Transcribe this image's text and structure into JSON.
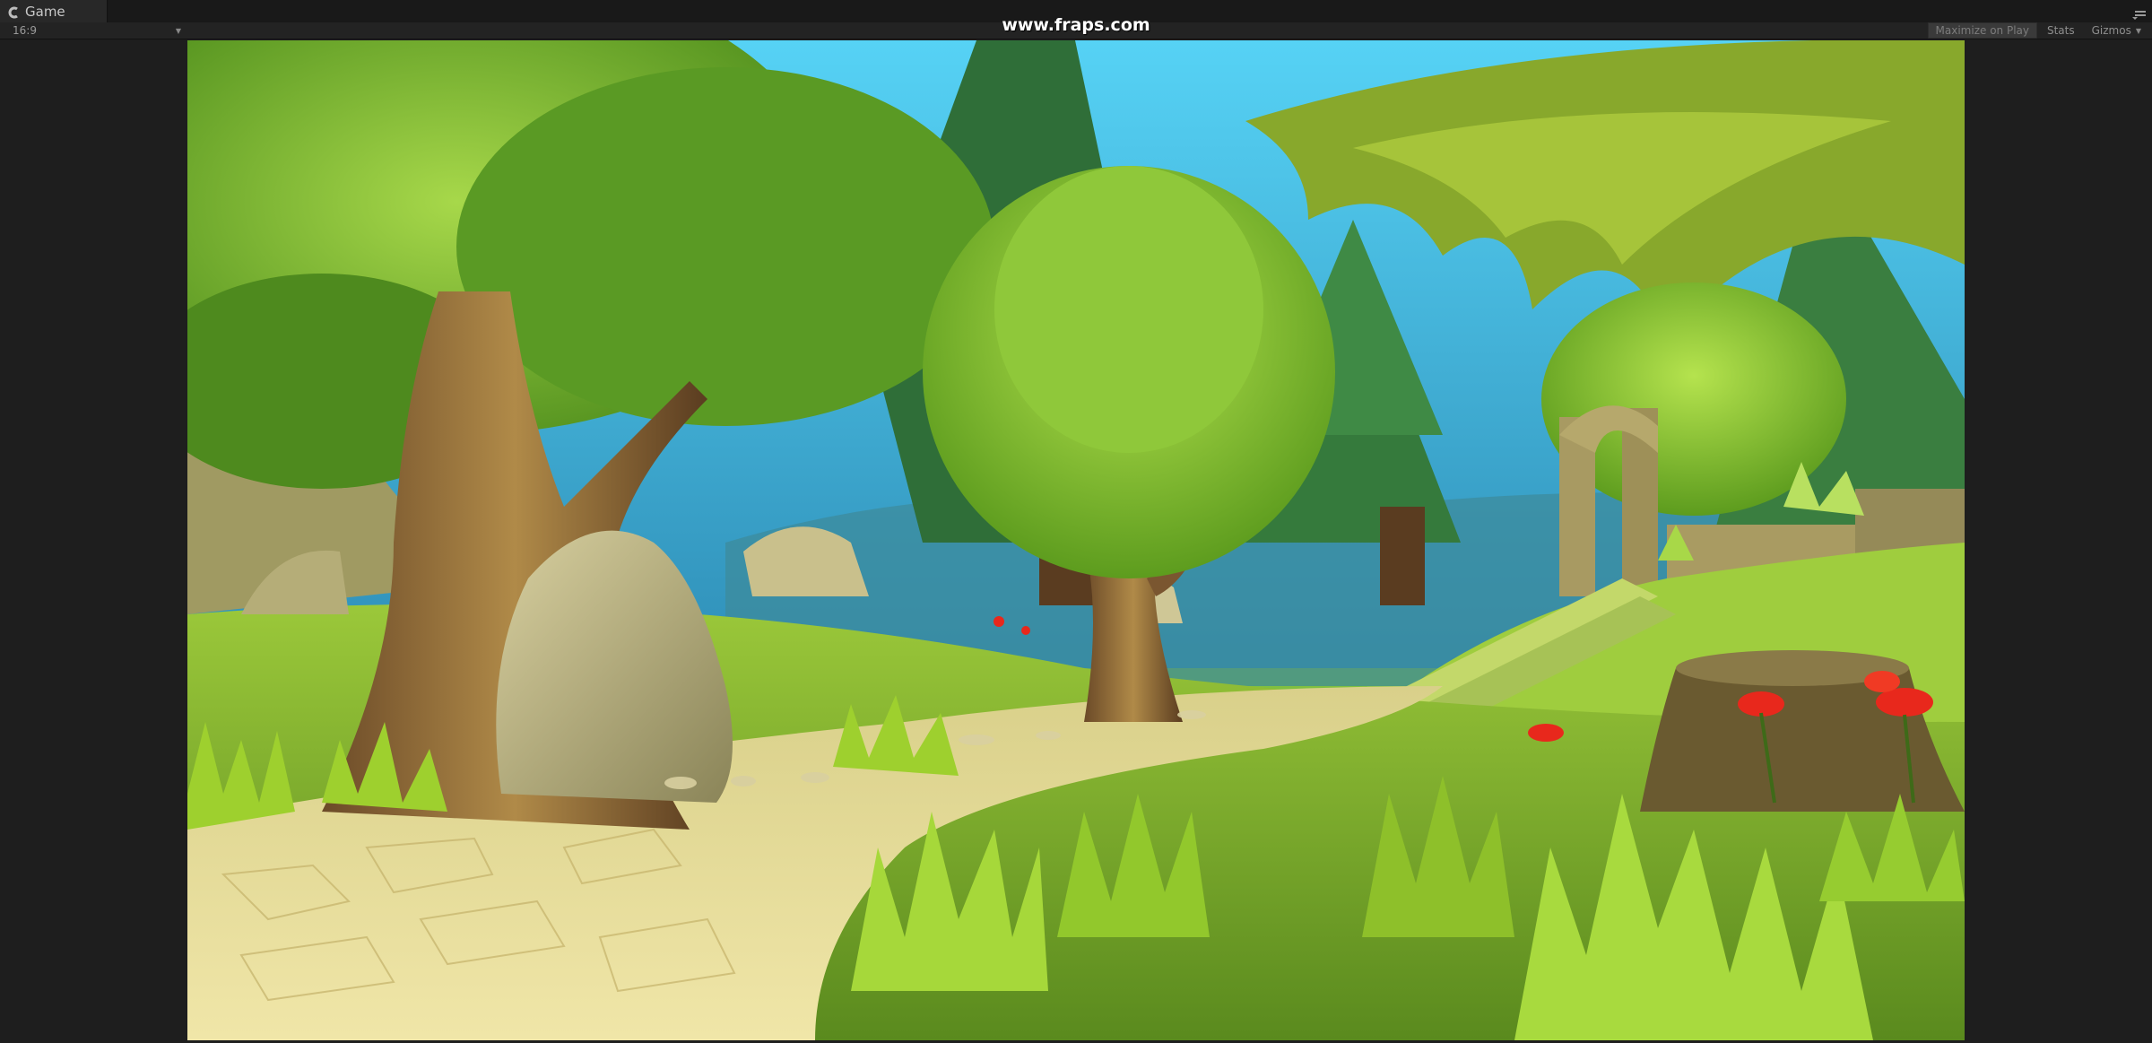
{
  "window": {
    "tab_title": "Game",
    "tab_icon": "unity-game-icon",
    "menu_icon": "panel-menu-icon"
  },
  "toolbar": {
    "aspect_ratio": "16:9",
    "overlay_text": "www.fraps.com",
    "maximize_on_play": "Maximize on Play",
    "maximize_on_play_active": true,
    "stats": "Stats",
    "gizmos": "Gizmos"
  },
  "scene": {
    "description_colors": {
      "sky": "#4fc3e8",
      "foliage": "#7cc030",
      "path": "#e8d98a",
      "flowers": "#e8281c"
    }
  }
}
